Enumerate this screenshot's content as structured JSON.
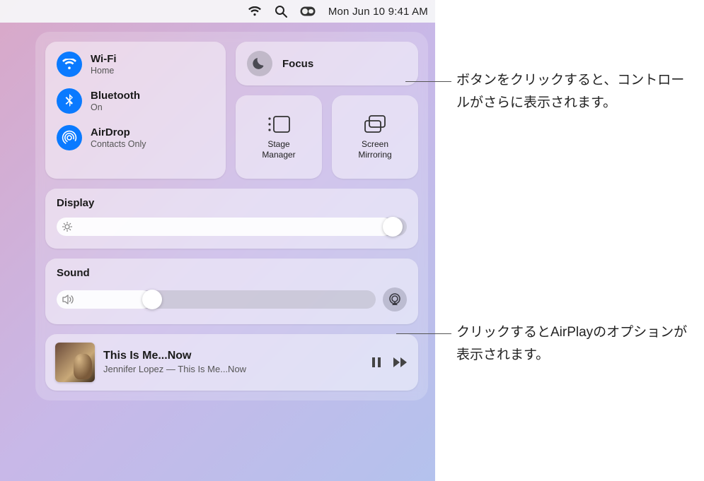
{
  "menubar": {
    "datetime": "Mon Jun 10  9:41 AM"
  },
  "connectivity": {
    "wifi": {
      "title": "Wi-Fi",
      "sub": "Home"
    },
    "bluetooth": {
      "title": "Bluetooth",
      "sub": "On"
    },
    "airdrop": {
      "title": "AirDrop",
      "sub": "Contacts Only"
    }
  },
  "focus": {
    "label": "Focus"
  },
  "stage_manager": {
    "label": "Stage\nManager"
  },
  "screen_mirroring": {
    "label": "Screen\nMirroring"
  },
  "display": {
    "title": "Display",
    "value_pct": 96
  },
  "sound": {
    "title": "Sound",
    "value_pct": 30
  },
  "now_playing": {
    "title": "This Is Me...Now",
    "subtitle": "Jennifer Lopez — This Is Me...Now"
  },
  "callouts": {
    "focus_hint": "ボタンをクリックすると、コントロールがさらに表示されます。",
    "airplay_hint": "クリックするとAirPlayのオプションが表示されます。"
  },
  "colors": {
    "accent_blue": "#0a7aff"
  }
}
